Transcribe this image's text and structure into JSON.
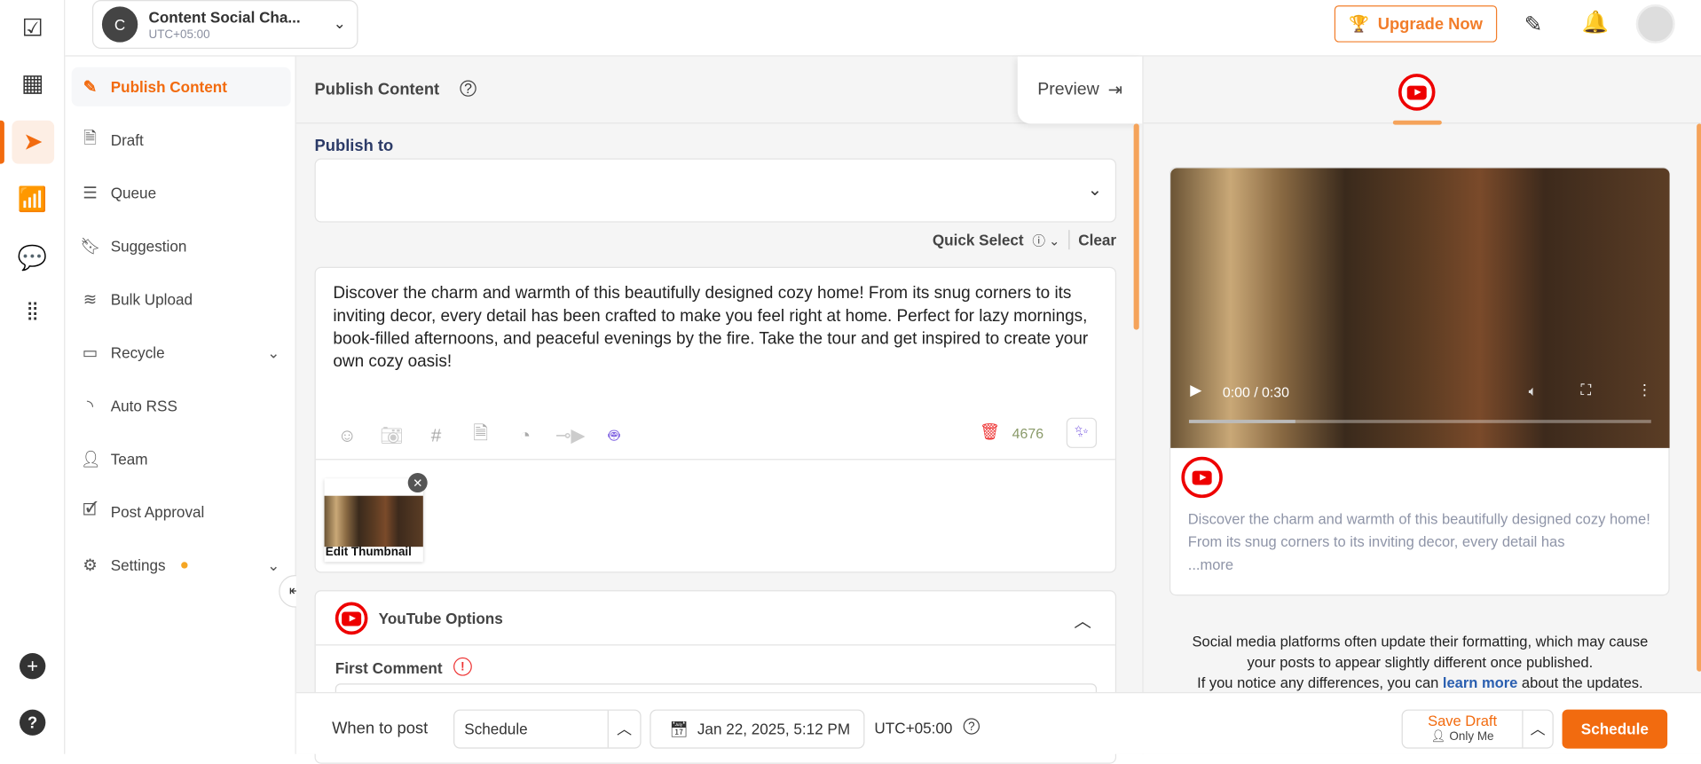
{
  "workspace": {
    "initial": "C",
    "name": "Content Social Cha...",
    "timezone": "UTC+05:00"
  },
  "header": {
    "upgrade_label": "Upgrade Now"
  },
  "sidebar": {
    "items": [
      {
        "label": "Publish Content"
      },
      {
        "label": "Draft"
      },
      {
        "label": "Queue"
      },
      {
        "label": "Suggestion"
      },
      {
        "label": "Bulk Upload"
      },
      {
        "label": "Recycle"
      },
      {
        "label": "Auto RSS"
      },
      {
        "label": "Team"
      },
      {
        "label": "Post Approval"
      },
      {
        "label": "Settings"
      }
    ]
  },
  "editor": {
    "title": "Publish Content",
    "preview_label": "Preview",
    "publish_to_label": "Publish to",
    "quick_select": "Quick Select",
    "clear": "Clear",
    "text": "Discover the charm and warmth of this beautifully designed cozy home! From its snug corners to its inviting decor, every detail has been crafted to make you feel right at home. Perfect for lazy mornings, book-filled afternoons, and peaceful evenings by the fire. Take the tour and get inspired to create your own cozy oasis!",
    "char_count": "4676",
    "thumbnail_label": "Edit Thumbnail",
    "youtube_options": "YouTube Options",
    "first_comment": "First Comment"
  },
  "preview": {
    "video_time": "0:00 / 0:30",
    "video_progress": 0.23,
    "caption": "Discover the charm and warmth of this beautifully designed cozy home! From its snug corners to its inviting decor, every detail has",
    "more": "...more",
    "notice1": "Social media platforms often update their formatting, which may cause",
    "notice2": "your posts to appear slightly different once published.",
    "notice3a": "If you notice any differences, you can ",
    "notice_link": "learn more",
    "notice3b": " about the updates."
  },
  "bottom": {
    "when_label": "When to post",
    "mode": "Schedule",
    "datetime": "Jan 22, 2025, 5:12 PM",
    "timezone": "UTC+05:00",
    "save_draft": "Save Draft",
    "visibility": "Only Me",
    "schedule": "Schedule"
  },
  "colors": {
    "accent": "#f26b0f",
    "youtube": "#e00000"
  }
}
